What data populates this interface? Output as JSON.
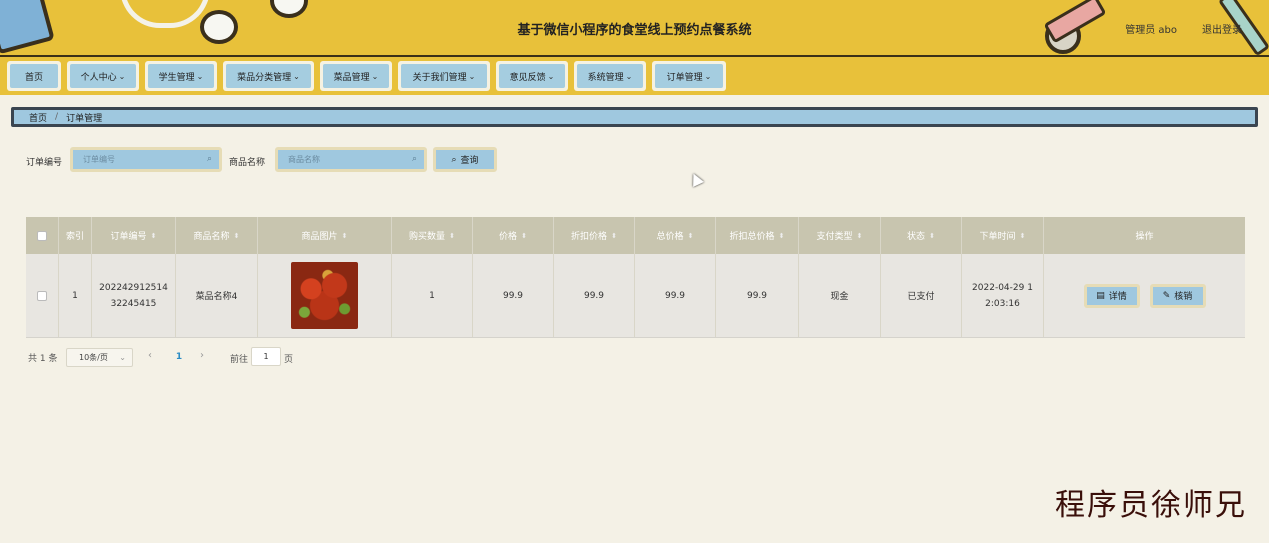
{
  "header": {
    "title": "基于微信小程序的食堂线上预约点餐系统",
    "user": "管理员 abo",
    "logout": "退出登录"
  },
  "nav": [
    {
      "label": "首页",
      "has_dropdown": false
    },
    {
      "label": "个人中心",
      "has_dropdown": true
    },
    {
      "label": "学生管理",
      "has_dropdown": true
    },
    {
      "label": "菜品分类管理",
      "has_dropdown": true
    },
    {
      "label": "菜品管理",
      "has_dropdown": true
    },
    {
      "label": "关于我们管理",
      "has_dropdown": true
    },
    {
      "label": "意见反馈",
      "has_dropdown": true
    },
    {
      "label": "系统管理",
      "has_dropdown": true
    },
    {
      "label": "订单管理",
      "has_dropdown": true
    }
  ],
  "breadcrumb": {
    "home": "首页",
    "current": "订单管理"
  },
  "search": {
    "order_no_label": "订单编号",
    "order_no_placeholder": "订单编号",
    "product_name_label": "商品名称",
    "product_name_placeholder": "商品名称",
    "button": "查询"
  },
  "table": {
    "headers": [
      "索引",
      "订单编号",
      "商品名称",
      "商品图片",
      "购买数量",
      "价格",
      "折扣价格",
      "总价格",
      "折扣总价格",
      "支付类型",
      "状态",
      "下单时间",
      "操作"
    ],
    "rows": [
      {
        "index": "1",
        "order_no_line1": "202242912514",
        "order_no_line2": "32245415",
        "product_name": "菜品名称4",
        "quantity": "1",
        "price": "99.9",
        "discount_price": "99.9",
        "total_price": "99.9",
        "discount_total": "99.9",
        "pay_type": "现金",
        "status": "已支付",
        "time_line1": "2022-04-29 1",
        "time_line2": "2:03:16",
        "detail_btn": "详情",
        "verify_btn": "核销"
      }
    ]
  },
  "pagination": {
    "total": "共 1 条",
    "page_size": "10条/页",
    "current_page": "1",
    "goto_label": "前往",
    "goto_value": "1",
    "goto_unit": "页"
  },
  "watermark": "程序员徐师兄",
  "colors": {
    "header_bg": "#e8c13a",
    "button_bg": "#9fc8df",
    "page_bg": "#f4f1e6",
    "table_header_bg": "#c8c5af"
  }
}
